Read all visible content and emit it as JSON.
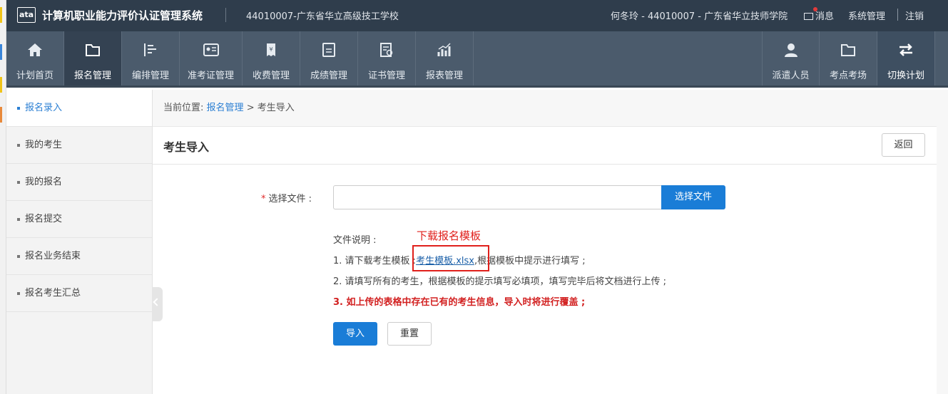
{
  "header": {
    "logo_text": "ata",
    "system_title": "计算机职业能力评价认证管理系统",
    "organization": "44010007-广东省华立高级技工学校",
    "user": "何冬玲 - 44010007 - 广东省华立技师学院",
    "messages_label": "消息",
    "system_admin_label": "系统管理",
    "logout_label": "注销"
  },
  "nav": {
    "items": [
      {
        "label": "计划首页",
        "icon": "home-icon"
      },
      {
        "label": "报名管理",
        "icon": "folder-icon"
      },
      {
        "label": "编排管理",
        "icon": "arrange-icon"
      },
      {
        "label": "准考证管理",
        "icon": "id-card-icon"
      },
      {
        "label": "收费管理",
        "icon": "fee-icon"
      },
      {
        "label": "成绩管理",
        "icon": "score-icon"
      },
      {
        "label": "证书管理",
        "icon": "certificate-icon"
      },
      {
        "label": "报表管理",
        "icon": "report-icon"
      }
    ],
    "right_items": [
      {
        "label": "派遣人员",
        "icon": "person-icon"
      },
      {
        "label": "考点考场",
        "icon": "folder-icon"
      },
      {
        "label": "切换计划",
        "icon": "switch-icon"
      }
    ]
  },
  "sidebar": {
    "items": [
      {
        "label": "报名录入"
      },
      {
        "label": "我的考生"
      },
      {
        "label": "我的报名"
      },
      {
        "label": "报名提交"
      },
      {
        "label": "报名业务结束"
      },
      {
        "label": "报名考生汇总"
      }
    ]
  },
  "breadcrumb": {
    "prefix": "当前位置:",
    "section": "报名管理",
    "separator": ">",
    "current": "考生导入"
  },
  "page": {
    "title": "考生导入",
    "back_label": "返回"
  },
  "form": {
    "file_label": "选择文件 :",
    "file_value": "",
    "choose_file_label": "选择文件",
    "desc_title": "文件说明 :",
    "line1_prefix": "1. 请下载考生模板 :",
    "template_link": "考生模板.xlsx",
    "line1_suffix": ",根据模板中提示进行填写 ;",
    "line2": "2. 请填写所有的考生，根据模板的提示填写必填项，填写完毕后将文档进行上传 ;",
    "line3": "3. 如上传的表格中存在已有的考生信息，导入时将进行覆盖 ;",
    "import_label": "导入",
    "reset_label": "重置"
  },
  "annotation": {
    "text": "下载报名模板"
  },
  "colors": {
    "header_bg": "#2f3d4c",
    "nav_bg": "#4b5b6c",
    "accent": "#1a7dd7",
    "warning": "#d22020",
    "annotation": "#e0201b"
  }
}
